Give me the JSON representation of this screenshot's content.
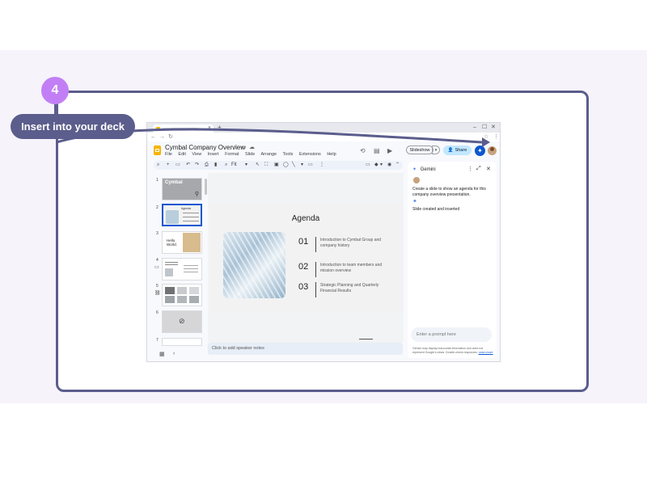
{
  "tutorial": {
    "step_number": "4",
    "callout_label": "Insert into your deck",
    "accent_color": "#c27ff5",
    "frame_color": "#5b5d8c"
  },
  "browser": {
    "new_tab": "+",
    "tab_close": "×",
    "window_controls": [
      "–",
      "☐",
      "✕"
    ],
    "nav": [
      "←",
      "→",
      "↻"
    ]
  },
  "doc": {
    "title": "Cymbal Company Overview",
    "menu": [
      "File",
      "Edit",
      "View",
      "Insert",
      "Format",
      "Slide",
      "Arrange",
      "Tools",
      "Extensions",
      "Help"
    ],
    "slideshow_label": "Slideshow",
    "share_label": "Share"
  },
  "toolbar": {
    "zoom": "Fit"
  },
  "filmstrip": {
    "slides": [
      {
        "number": "1",
        "text": "Cymbal"
      },
      {
        "number": "2",
        "text": "Agenda"
      },
      {
        "number": "3",
        "text": "Hello World."
      },
      {
        "number": "4",
        "text": ""
      },
      {
        "number": "5",
        "text": ""
      },
      {
        "number": "6",
        "text": ""
      },
      {
        "number": "7",
        "text": ""
      }
    ]
  },
  "slide": {
    "title": "Agenda",
    "items": [
      {
        "number": "01",
        "text": "Introduction to Cymbal Group and company history"
      },
      {
        "number": "02",
        "text": "Introduction to team members and mission overview"
      },
      {
        "number": "03",
        "text": "Strategic Planning and Quarterly Financial Results"
      }
    ]
  },
  "notes": {
    "placeholder": "Click to add speaker notes"
  },
  "gemini": {
    "title": "Gemini",
    "user_prompt": "Create a slide to show an agenda for this company overview presentation.",
    "reply": "Slide created and inserted",
    "input_placeholder": "Enter a prompt here",
    "disclaimer": "Gemini may display inaccurate information and does not represent Google's views. Double-check responses.",
    "disclaimer_link": "Learn more"
  }
}
